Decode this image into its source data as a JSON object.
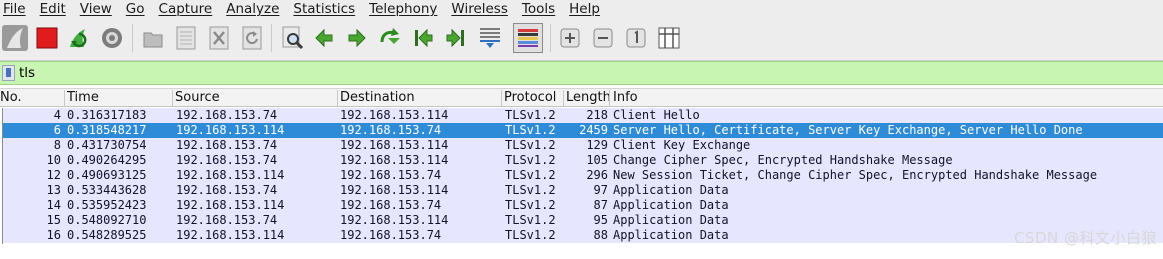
{
  "menu": [
    "File",
    "Edit",
    "View",
    "Go",
    "Capture",
    "Analyze",
    "Statistics",
    "Telephony",
    "Wireless",
    "Tools",
    "Help"
  ],
  "toolbar": {
    "icons": [
      "shark-fin-icon",
      "stop-capture-icon",
      "restart-capture-icon",
      "capture-options-icon",
      "open-file-icon",
      "save-file-icon",
      "close-file-icon",
      "reload-file-icon",
      "find-packet-icon",
      "go-back-icon",
      "go-forward-icon",
      "go-to-packet-icon",
      "first-packet-icon",
      "last-packet-icon",
      "autoscroll-icon",
      "colorize-icon",
      "zoom-in-icon",
      "zoom-out-icon",
      "normal-size-icon",
      "resize-columns-icon"
    ]
  },
  "filter": {
    "value": "tls"
  },
  "columns": {
    "no": "No.",
    "time": "Time",
    "source": "Source",
    "destination": "Destination",
    "protocol": "Protocol",
    "length": "Length",
    "info": "Info"
  },
  "packets": [
    {
      "no": "4",
      "time": "0.316317183",
      "source": "192.168.153.74",
      "destination": "192.168.153.114",
      "protocol": "TLSv1.2",
      "length": "218",
      "info": "Client Hello"
    },
    {
      "no": "6",
      "time": "0.318548217",
      "source": "192.168.153.114",
      "destination": "192.168.153.74",
      "protocol": "TLSv1.2",
      "length": "2459",
      "info": "Server Hello, Certificate, Server Key Exchange, Server Hello Done"
    },
    {
      "no": "8",
      "time": "0.431730754",
      "source": "192.168.153.74",
      "destination": "192.168.153.114",
      "protocol": "TLSv1.2",
      "length": "129",
      "info": "Client Key Exchange"
    },
    {
      "no": "10",
      "time": "0.490264295",
      "source": "192.168.153.74",
      "destination": "192.168.153.114",
      "protocol": "TLSv1.2",
      "length": "105",
      "info": "Change Cipher Spec, Encrypted Handshake Message"
    },
    {
      "no": "12",
      "time": "0.490693125",
      "source": "192.168.153.114",
      "destination": "192.168.153.74",
      "protocol": "TLSv1.2",
      "length": "296",
      "info": "New Session Ticket, Change Cipher Spec, Encrypted Handshake Message"
    },
    {
      "no": "13",
      "time": "0.533443628",
      "source": "192.168.153.74",
      "destination": "192.168.153.114",
      "protocol": "TLSv1.2",
      "length": "97",
      "info": "Application Data"
    },
    {
      "no": "14",
      "time": "0.535952423",
      "source": "192.168.153.114",
      "destination": "192.168.153.74",
      "protocol": "TLSv1.2",
      "length": "87",
      "info": "Application Data"
    },
    {
      "no": "15",
      "time": "0.548092710",
      "source": "192.168.153.74",
      "destination": "192.168.153.114",
      "protocol": "TLSv1.2",
      "length": "95",
      "info": "Application Data"
    },
    {
      "no": "16",
      "time": "0.548289525",
      "source": "192.168.153.114",
      "destination": "192.168.153.74",
      "protocol": "TLSv1.2",
      "length": "88",
      "info": "Application Data"
    }
  ],
  "selected_row": 1,
  "colors": {
    "row_bg": "#e7e6ff",
    "selected_bg": "#2e8bd7",
    "filter_bg": "#c9f5b3"
  },
  "watermark": "CSDN @科文小白狼"
}
